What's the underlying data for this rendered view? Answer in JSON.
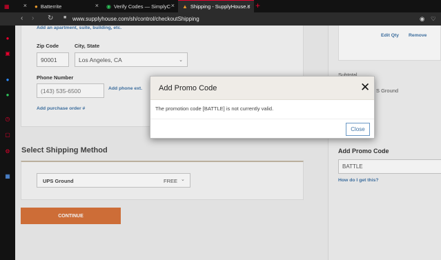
{
  "browser": {
    "tabs": [
      {
        "label": "",
        "icon": "gamepad-icon",
        "active": false
      },
      {
        "label": "Batterrite",
        "icon": "battery-icon",
        "active": false
      },
      {
        "label": "Verify Codes — SimplyCod",
        "icon": "verified-icon",
        "active": false
      },
      {
        "label": "Shipping - SupplyHouse.co",
        "icon": "supplyhouse-icon",
        "active": true
      }
    ],
    "new_tab": "+",
    "url": "www.supplyhouse.com/sh/control/checkoutShipping"
  },
  "address_form": {
    "apartment_link": "Add an apartment, suite, building, etc.",
    "zip_label": "Zip Code",
    "zip_value": "90001",
    "city_label": "City, State",
    "city_value": "Los Angeles, CA",
    "phone_label": "Phone Number",
    "phone_placeholder": "(143) 535-6500",
    "add_phone_ext": "Add phone ext.",
    "add_po": "Add purchase order #"
  },
  "shipping": {
    "section_title": "Select Shipping Method",
    "method": "UPS Ground",
    "price": "FREE",
    "continue_label": "CONTINUE"
  },
  "summary": {
    "edit_qty": "Edit Qty",
    "remove": "Remove",
    "subtotal_label": "Subtotal",
    "shipping_partial": "S Ground",
    "promo_title": "Add Promo Code",
    "promo_value": "BATTLE",
    "promo_help": "How do I get this?"
  },
  "modal": {
    "title": "Add Promo Code",
    "message": "The promotion code [BATTLE] is not currently valid.",
    "close_label": "Close"
  },
  "colors": {
    "accent": "#e8002d",
    "continue_button": "#d9733a",
    "link": "#3f73a6"
  }
}
